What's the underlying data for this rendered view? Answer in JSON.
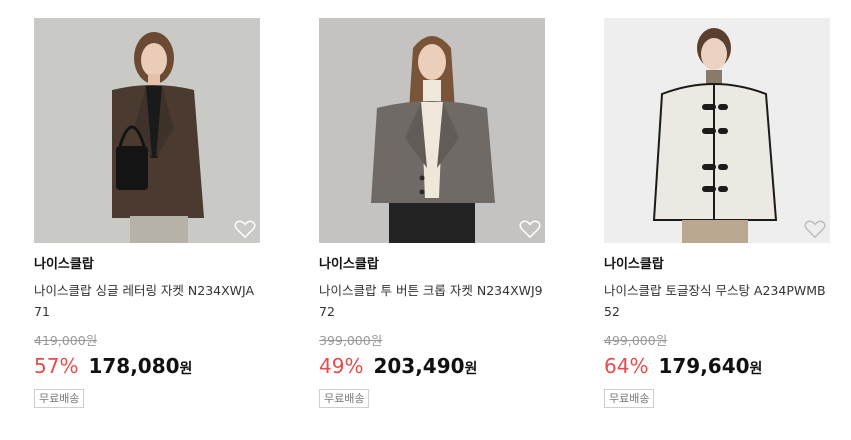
{
  "products": [
    {
      "brand": "나이스클랍",
      "name": "나이스클랍 싱글 레터링 자켓 N234XWJA71",
      "original_price": "419,000원",
      "discount": "57%",
      "sale_price": "178,080",
      "currency": "원",
      "badge": "무료배송",
      "photo_desc": "model-in-brown-jacket",
      "bg_color": "#c9c9c6",
      "jacket_color": "#4a3a30"
    },
    {
      "brand": "나이스클랍",
      "name": "나이스클랍 투 버튼 크롭 자켓 N234XWJ972",
      "original_price": "399,000원",
      "discount": "49%",
      "sale_price": "203,490",
      "currency": "원",
      "badge": "무료배송",
      "photo_desc": "model-in-grey-crop-jacket",
      "bg_color": "#c4c3c1",
      "jacket_color": "#6f6a66"
    },
    {
      "brand": "나이스클랍",
      "name": "나이스클랍 토글장식 무스탕 A234PWMB52",
      "original_price": "499,000원",
      "discount": "64%",
      "sale_price": "179,640",
      "currency": "원",
      "badge": "무료배송",
      "photo_desc": "model-in-ivory-mustang",
      "bg_color": "#eeeeee",
      "jacket_color": "#ece9e2"
    }
  ],
  "icons": {
    "wishlist": "heart-outline-icon"
  },
  "colors": {
    "discount": "#e74c4c",
    "price": "#111111"
  }
}
